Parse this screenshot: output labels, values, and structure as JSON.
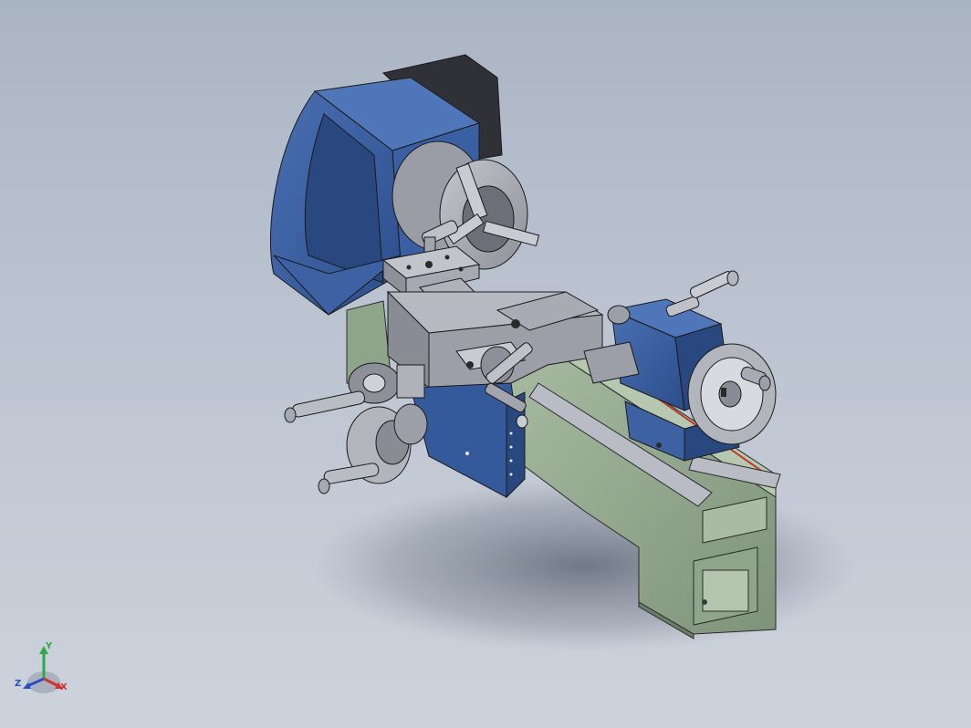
{
  "viewport": {
    "background_top": "#aab5c4",
    "background_bottom": "#cdd3dc"
  },
  "model": {
    "colors": {
      "headstock_blue": "#355a9c",
      "bed_green": "#93a88d",
      "metal_gray": "#a7a9b4",
      "dark_gray": "#3d3f45",
      "rail_red": "#c0392b"
    }
  },
  "triad": {
    "x_label": "X",
    "y_label": "Y",
    "z_label": "Z",
    "x_color": "#d43030",
    "y_color": "#2ea84a",
    "z_color": "#2a4fc4"
  }
}
